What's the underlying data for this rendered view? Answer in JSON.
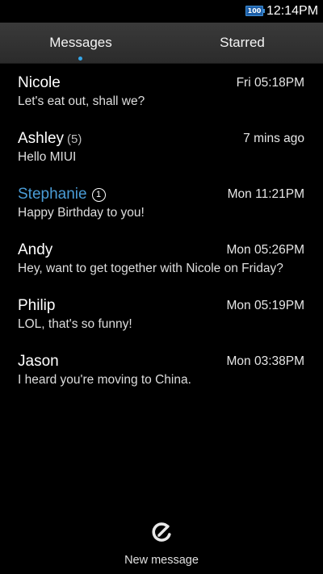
{
  "status_bar": {
    "battery_level": "100",
    "time": "12:14PM",
    "battery_icon": "battery-icon"
  },
  "tabs": {
    "active": "messages",
    "items": [
      {
        "id": "messages",
        "label": "Messages"
      },
      {
        "id": "starred",
        "label": "Starred"
      }
    ]
  },
  "messages": [
    {
      "sender": "Nicole",
      "count": "",
      "unread_count": "",
      "time": "Fri 05:18PM",
      "snippet": "Let's eat out, shall we?",
      "unread": false
    },
    {
      "sender": "Ashley",
      "count": "(5)",
      "unread_count": "",
      "time": "7 mins ago",
      "snippet": "Hello MIUI",
      "unread": false
    },
    {
      "sender": "Stephanie",
      "count": "",
      "unread_count": "1",
      "time": "Mon 11:21PM",
      "snippet": "Happy Birthday to you!",
      "unread": true
    },
    {
      "sender": "Andy",
      "count": "",
      "unread_count": "",
      "time": "Mon 05:26PM",
      "snippet": "Hey, want to get together with Nicole on Friday?",
      "unread": false
    },
    {
      "sender": "Philip",
      "count": "",
      "unread_count": "",
      "time": "Mon 05:19PM",
      "snippet": "LOL, that's so funny!",
      "unread": false
    },
    {
      "sender": "Jason",
      "count": "",
      "unread_count": "",
      "time": "Mon 03:38PM",
      "snippet": "I heard you're moving to China.",
      "unread": false
    }
  ],
  "new_message": {
    "label": "New message",
    "icon": "compose-icon"
  },
  "colors": {
    "background": "#000000",
    "tab_bar": "#333333",
    "accent": "#35a6e8",
    "unread_sender": "#4a9cd6",
    "battery": "#1d5fa8"
  }
}
